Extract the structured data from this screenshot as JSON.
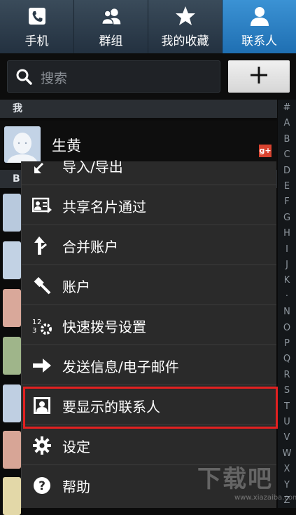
{
  "tabs": [
    {
      "label": "手机",
      "icon": "phone-icon"
    },
    {
      "label": "群组",
      "icon": "group-icon"
    },
    {
      "label": "我的收藏",
      "icon": "star-icon"
    },
    {
      "label": "联系人",
      "icon": "person-icon",
      "active": true
    }
  ],
  "search": {
    "placeholder": "搜索"
  },
  "sections": {
    "me": "我",
    "b": "B"
  },
  "me": {
    "name": "生黄",
    "badge": "g+"
  },
  "menu": {
    "items": [
      {
        "label": "导入/导出",
        "icon": "import-export-icon"
      },
      {
        "label": "共享名片通过",
        "icon": "share-card-icon"
      },
      {
        "label": "合并账户",
        "icon": "merge-icon"
      },
      {
        "label": "账户",
        "icon": "key-icon"
      },
      {
        "label": "快速拨号设置",
        "icon": "speed-dial-icon"
      },
      {
        "label": "发送信息/电子邮件",
        "icon": "send-arrow-icon"
      },
      {
        "label": "要显示的联系人",
        "icon": "contact-card-icon",
        "highlighted": true
      },
      {
        "label": "设定",
        "icon": "gear-icon"
      },
      {
        "label": "帮助",
        "icon": "help-icon"
      }
    ]
  },
  "index": [
    "#",
    "A",
    "B",
    "C",
    "D",
    "E",
    "F",
    "G",
    "H",
    "I",
    "J",
    "K",
    "·",
    "N",
    "O",
    "P",
    "Q",
    "R",
    "S",
    "T",
    "U",
    "V",
    "W",
    "X",
    "Y",
    "Z"
  ],
  "watermark": {
    "main": "下载吧",
    "sub": "www.xiazaiba.com"
  },
  "colors": {
    "active_tab": "#2a82c8",
    "highlight": "#e22020",
    "menu_bg": "#2a2a2a"
  }
}
